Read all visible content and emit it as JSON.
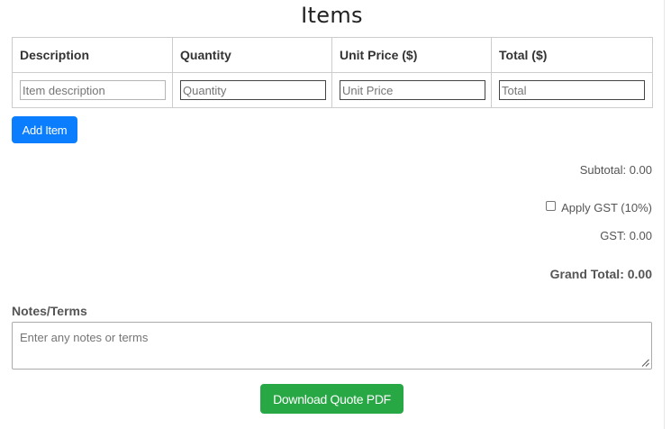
{
  "items_section": {
    "title": "Items"
  },
  "table": {
    "headers": [
      "Description",
      "Quantity",
      "Unit Price ($)",
      "Total ($)"
    ],
    "row_placeholders": [
      "Item description",
      "Quantity",
      "Unit Price",
      "Total"
    ]
  },
  "buttons": {
    "add_item": "Add Item",
    "download": "Download Quote PDF"
  },
  "summary": {
    "subtotal": "Subtotal: 0.00",
    "apply_gst_label": "Apply GST (10%)",
    "apply_gst_checked": false,
    "gst": "GST: 0.00",
    "grand_total": "Grand Total: 0.00"
  },
  "notes": {
    "label": "Notes/Terms",
    "placeholder": "Enter any notes or terms",
    "value": ""
  },
  "colors": {
    "add_item_button": "#0b7dff",
    "download_button": "#28a745",
    "table_border": "#cccccc"
  }
}
